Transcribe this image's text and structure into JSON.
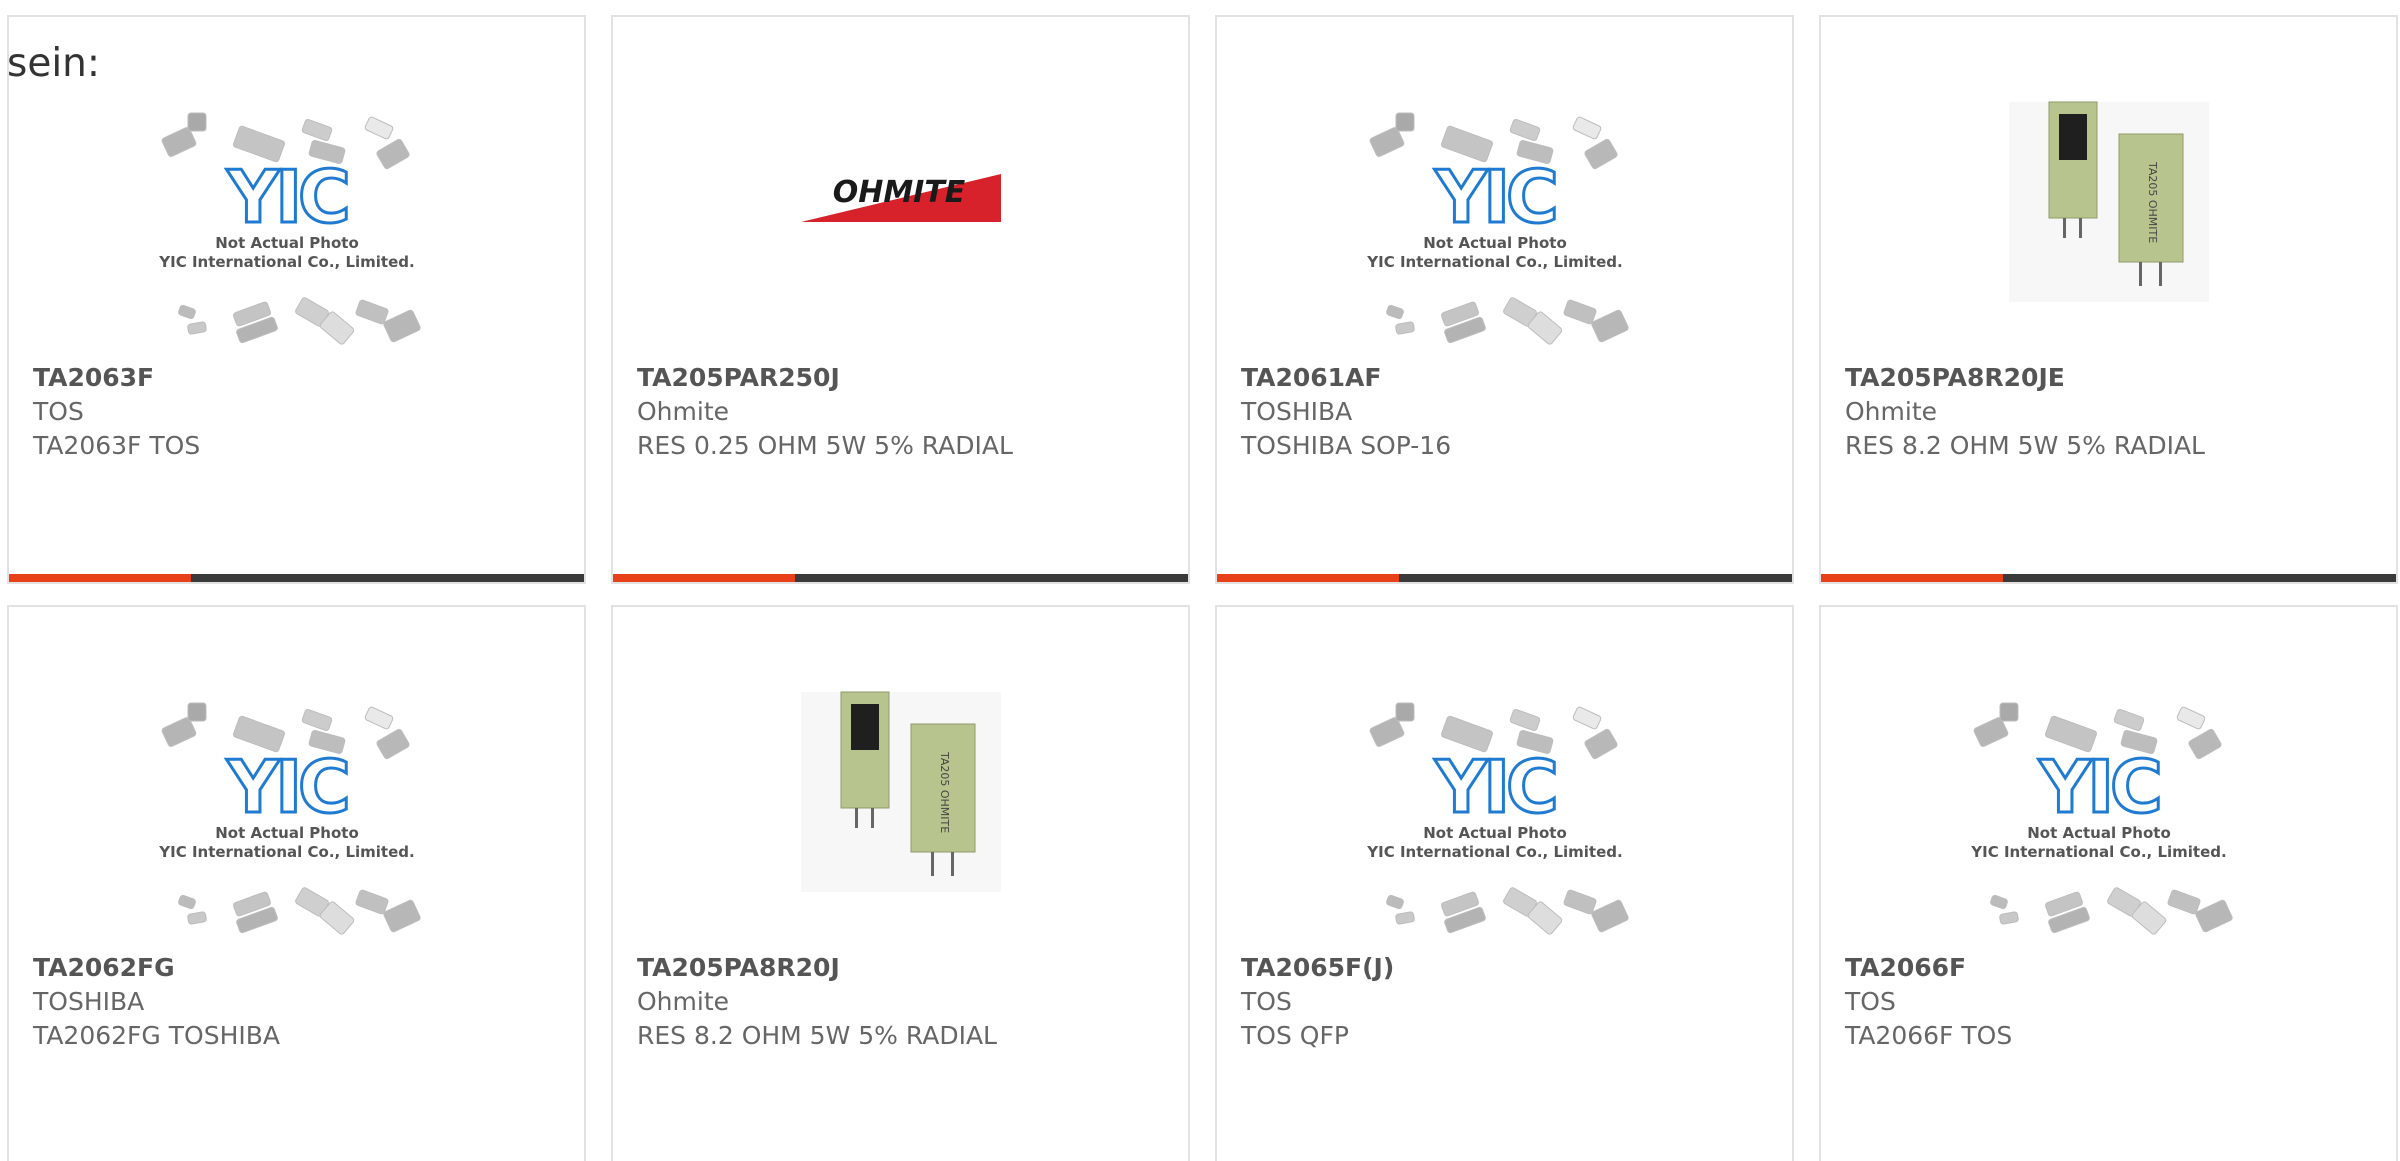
{
  "intro_text": "sein:",
  "colors": {
    "accent": "#e8411a",
    "bar": "#3a3a3a",
    "yic_blue": "#1f7ad1",
    "ohmite_red": "#d8222b",
    "resistor_green": "#b8c48e"
  },
  "placeholder_image": {
    "line1": "Not Actual Photo",
    "line2": "YIC International Co., Limited."
  },
  "ohmite_logo_text": "OHMITE",
  "resistor_markings": "TA205 OHMITE",
  "products": [
    {
      "part_number": "TA2063F",
      "manufacturer": "TOS",
      "description": "TA2063F TOS",
      "image": "yic-placeholder"
    },
    {
      "part_number": "TA205PAR250J",
      "manufacturer": "Ohmite",
      "description": "RES 0.25 OHM 5W 5% RADIAL",
      "image": "ohmite-logo"
    },
    {
      "part_number": "TA2061AF",
      "manufacturer": "TOSHIBA",
      "description": "TOSHIBA SOP-16",
      "image": "yic-placeholder"
    },
    {
      "part_number": "TA205PA8R20JE",
      "manufacturer": "Ohmite",
      "description": "RES 8.2 OHM 5W 5% RADIAL",
      "image": "resistor-photo"
    },
    {
      "part_number": "TA2062FG",
      "manufacturer": "TOSHIBA",
      "description": "TA2062FG TOSHIBA",
      "image": "yic-placeholder"
    },
    {
      "part_number": "TA205PA8R20J",
      "manufacturer": "Ohmite",
      "description": "RES 8.2 OHM 5W 5% RADIAL",
      "image": "resistor-photo"
    },
    {
      "part_number": "TA2065F(J)",
      "manufacturer": "TOS",
      "description": "TOS QFP",
      "image": "yic-placeholder"
    },
    {
      "part_number": "TA2066F",
      "manufacturer": "TOS",
      "description": "TA2066F TOS",
      "image": "yic-placeholder"
    }
  ]
}
